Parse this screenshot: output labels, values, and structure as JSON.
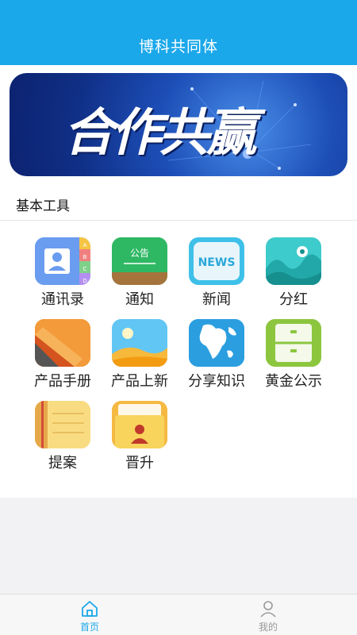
{
  "header": {
    "title": "博科共同体"
  },
  "banner": {
    "text": "合作共赢"
  },
  "tools_section": {
    "title": "基本工具",
    "items": [
      {
        "label": "通讯录",
        "icon": "contacts-icon"
      },
      {
        "label": "通知",
        "icon": "notice-board-icon"
      },
      {
        "label": "新闻",
        "icon": "news-icon"
      },
      {
        "label": "分红",
        "icon": "dividend-icon"
      },
      {
        "label": "产品手册",
        "icon": "manual-icon"
      },
      {
        "label": "产品上新",
        "icon": "new-product-icon"
      },
      {
        "label": "分享知识",
        "icon": "globe-icon"
      },
      {
        "label": "黄金公示",
        "icon": "cabinet-icon"
      },
      {
        "label": "提案",
        "icon": "notebook-icon"
      },
      {
        "label": "晋升",
        "icon": "id-card-icon"
      }
    ],
    "icon_texts": {
      "notice": "公告",
      "news": "NEWS",
      "contacts_letters": [
        "A",
        "B",
        "C",
        "D"
      ]
    }
  },
  "tabbar": {
    "tabs": [
      {
        "label": "首页",
        "icon": "home-icon",
        "active": true
      },
      {
        "label": "我的",
        "icon": "user-icon",
        "active": false
      }
    ]
  },
  "colors": {
    "primary": "#1ba8ea",
    "active_tab": "#1ba8ea",
    "inactive_tab": "#999999"
  }
}
